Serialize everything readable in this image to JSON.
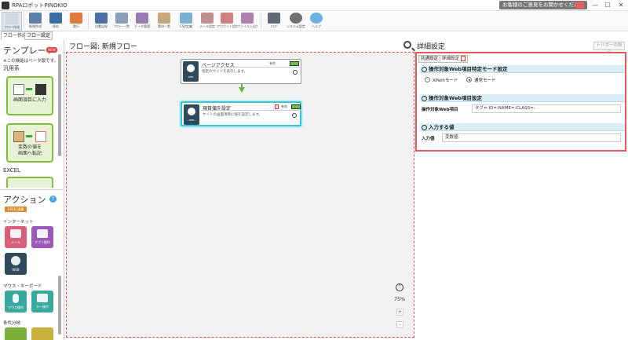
{
  "window": {
    "title": "RPAロボットPINOKIO",
    "feedback": "お客様のご意見をお聞かせください",
    "minimize": "—",
    "maximize": "☐",
    "close": "✕"
  },
  "ribbon": {
    "buttons": [
      {
        "label": "フロー作成",
        "color": "#cfd8e3"
      },
      {
        "label": "新規作成",
        "color": "#5b7fa8"
      },
      {
        "label": "保存",
        "color": "#3a6ea5"
      },
      {
        "label": "実行",
        "color": "#e07a3a"
      },
      {
        "label": "自動記録",
        "color": "#4a6fa0"
      },
      {
        "label": "フロー一覧",
        "color": "#8aa0b8"
      },
      {
        "label": "データ管理",
        "color": "#9a7bb0"
      },
      {
        "label": "素材一覧",
        "color": "#c8a878"
      },
      {
        "label": "CSV定義",
        "color": "#7ab0d0"
      },
      {
        "label": "メール設定",
        "color": "#c09090"
      },
      {
        "label": "アカウント設定",
        "color": "#d08080"
      },
      {
        "label": "ファイル入出力",
        "color": "#b080b0"
      },
      {
        "label": "ログ",
        "color": "#606878"
      },
      {
        "label": "システム設定",
        "color": "#707070"
      },
      {
        "label": "ヘルプ",
        "color": "#6ab0e0"
      }
    ]
  },
  "sidebar": {
    "tabs": [
      "フロー作成",
      "フロー設定"
    ],
    "template_title": "テンプレート",
    "new_badge": "NEW",
    "beta_note": "※この機能はベータ版です。",
    "general_label": "汎用系",
    "card1_label": "画面項目に入力",
    "card2_label": "変数の値を\n画面へ転記",
    "excel_label": "EXCEL",
    "action_title": "アクション",
    "help": "?",
    "orange_badge": "EXCEL連携",
    "internet_label": "インターネット",
    "tile_mail": "メール",
    "tile_app": "アプリ操作",
    "tile_web": "WEB",
    "mouse_label": "マウス・キーボード",
    "tile_mouse": "マウス操作",
    "tile_key": "キー操作",
    "condition_label": "条件分岐"
  },
  "flow": {
    "header": "フロー図:  新規フロー",
    "node1": {
      "title": "ページアクセス",
      "desc": "指定のサイトを表示します。",
      "flag": "有効",
      "icon_label": "WEB"
    },
    "node2": {
      "title": "項目値を設定",
      "desc": "サイトの画面項目に値を設定します。",
      "flag": "有効",
      "icon_label": "WEB",
      "warn": "!"
    },
    "zoom": "75%",
    "zoom_up": "^",
    "zoom_plus": "+",
    "zoom_minus": "-"
  },
  "details": {
    "title": "詳細設定",
    "trigger": "トリガーの設定",
    "tabs": [
      "共通設定",
      "詳細設定"
    ],
    "tab_warn": "!",
    "sec1": {
      "title": "操作対象Web項目特定モード設定",
      "xpath": "XPathモード",
      "normal": "通常モード"
    },
    "sec2": {
      "title": "操作対象Web項目設定",
      "label": "操作対象Web項目",
      "value": "タグ=:ID=:NAME=:CLASS=:"
    },
    "sec3": {
      "title": "入力する値",
      "label": "入力値",
      "value": "変数値:"
    }
  }
}
